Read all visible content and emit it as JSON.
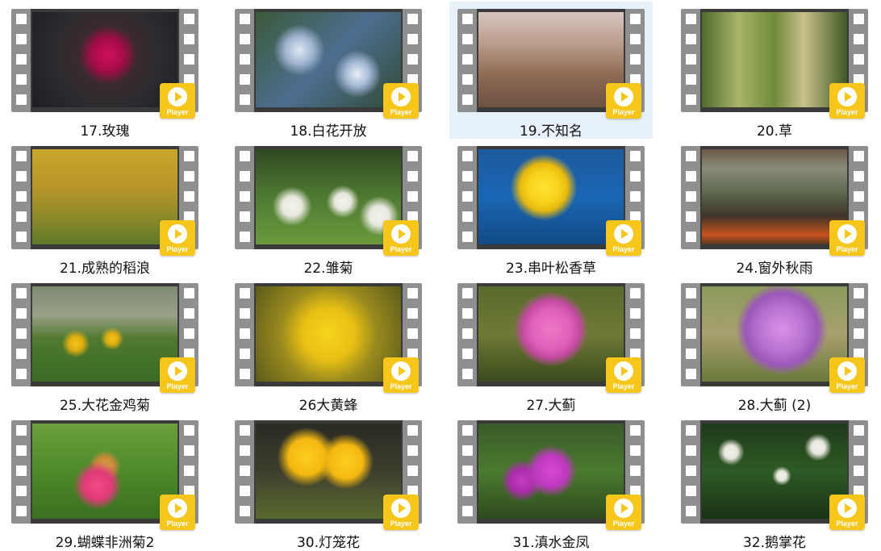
{
  "badge_label": "Player",
  "colors": {
    "badge": "#f6c61b",
    "selected_bg": "#e6f1fb",
    "film": "#8f8f8f"
  },
  "videos": [
    {
      "title": "17.玫瑰"
    },
    {
      "title": "18.白花开放"
    },
    {
      "title": "19.不知名"
    },
    {
      "title": "20.草"
    },
    {
      "title": "21.成熟的稻浪"
    },
    {
      "title": "22.雏菊"
    },
    {
      "title": "23.串叶松香草"
    },
    {
      "title": "24.窗外秋雨"
    },
    {
      "title": "25.大花金鸡菊"
    },
    {
      "title": "26大黄蜂"
    },
    {
      "title": "27.大蓟"
    },
    {
      "title": "28.大蓟 (2)"
    },
    {
      "title": "29.蝴蝶非洲菊2"
    },
    {
      "title": "30.灯笼花"
    },
    {
      "title": "31.滇水金凤"
    },
    {
      "title": "32.鹅掌花"
    }
  ]
}
